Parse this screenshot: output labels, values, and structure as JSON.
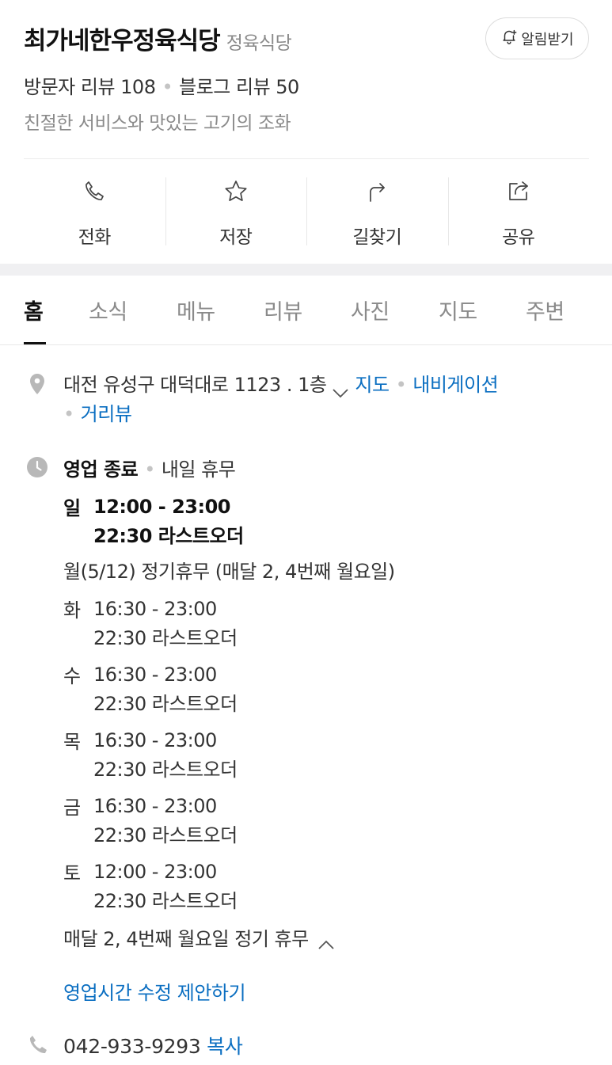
{
  "place": {
    "name": "최가네한우정육식당",
    "category": "정육식당",
    "visitor_reviews": "방문자 리뷰 108",
    "blog_reviews": "블로그 리뷰 50",
    "description": "친절한 서비스와 맛있는 고기의 조화",
    "alarm_label": "알림받기"
  },
  "actions": [
    {
      "label": "전화",
      "icon": "phone-icon"
    },
    {
      "label": "저장",
      "icon": "star-icon"
    },
    {
      "label": "길찾기",
      "icon": "directions-icon"
    },
    {
      "label": "공유",
      "icon": "share-icon"
    }
  ],
  "tabs": [
    "홈",
    "소식",
    "메뉴",
    "리뷰",
    "사진",
    "지도",
    "주변"
  ],
  "active_tab": "홈",
  "address": {
    "text": "대전 유성구 대덕대로 1123 . 1층",
    "map_link": "지도",
    "navi_link": "내비게이션",
    "street_link": "거리뷰"
  },
  "business": {
    "status": "영업 종료",
    "next": "내일 휴무",
    "hours": [
      {
        "day": "일",
        "time": "12:00 - 23:00",
        "last_order": "22:30 라스트오더"
      },
      {
        "day": "화",
        "time": "16:30 - 23:00",
        "last_order": "22:30 라스트오더"
      },
      {
        "day": "수",
        "time": "16:30 - 23:00",
        "last_order": "22:30 라스트오더"
      },
      {
        "day": "목",
        "time": "16:30 - 23:00",
        "last_order": "22:30 라스트오더"
      },
      {
        "day": "금",
        "time": "16:30 - 23:00",
        "last_order": "22:30 라스트오더"
      },
      {
        "day": "토",
        "time": "12:00 - 23:00",
        "last_order": "22:30 라스트오더"
      }
    ],
    "holiday_line": "월(5/12)  정기휴무 (매달 2, 4번째 월요일)",
    "closed_note": "매달 2, 4번째 월요일 정기 휴무",
    "suggest_edit": "영업시간 수정 제안하기"
  },
  "phone": {
    "number": "042-933-9293",
    "copy_label": "복사"
  },
  "colors": {
    "link": "#0a6ec1",
    "muted": "#8a8a8a",
    "icon_gray": "#b8b8b8"
  }
}
